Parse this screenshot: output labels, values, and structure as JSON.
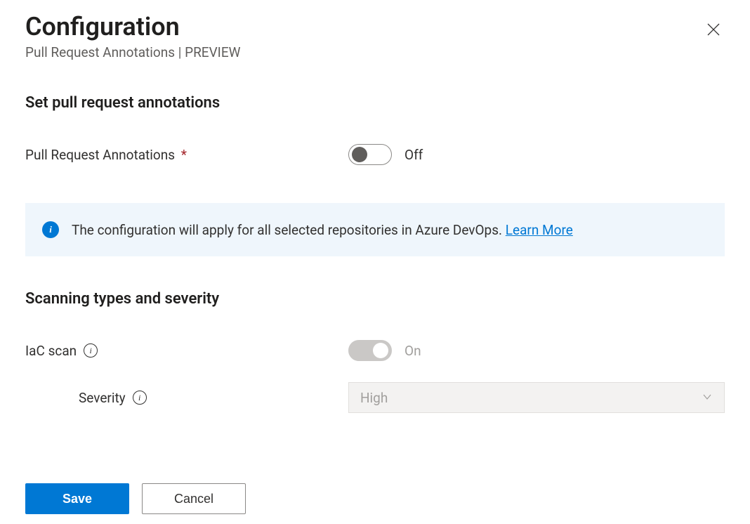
{
  "header": {
    "title": "Configuration",
    "subtitle": "Pull Request Annotations | PREVIEW"
  },
  "section1": {
    "heading": "Set pull request annotations",
    "toggle_label": "Pull Request Annotations",
    "required_marker": "*",
    "toggle_state": "Off"
  },
  "info": {
    "text": "The configuration will apply for all selected repositories in Azure DevOps. ",
    "link": "Learn More"
  },
  "section2": {
    "heading": "Scanning types and severity",
    "iac_label": "IaC scan",
    "iac_toggle_state": "On",
    "severity_label": "Severity",
    "severity_value": "High"
  },
  "footer": {
    "save": "Save",
    "cancel": "Cancel"
  }
}
